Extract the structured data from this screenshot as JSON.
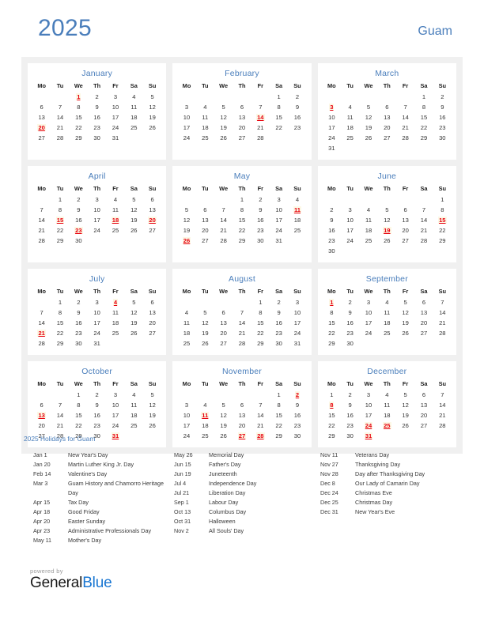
{
  "header": {
    "year": "2025",
    "country": "Guam"
  },
  "months": [
    {
      "name": "January",
      "weekdays": [
        "Mo",
        "Tu",
        "We",
        "Th",
        "Fr",
        "Sa",
        "Su"
      ],
      "weeks": [
        [
          "",
          "",
          "1",
          "2",
          "3",
          "4",
          "5"
        ],
        [
          "6",
          "7",
          "8",
          "9",
          "10",
          "11",
          "12"
        ],
        [
          "13",
          "14",
          "15",
          "16",
          "17",
          "18",
          "19"
        ],
        [
          "20",
          "21",
          "22",
          "23",
          "24",
          "25",
          "26"
        ],
        [
          "27",
          "28",
          "29",
          "30",
          "31",
          "",
          ""
        ]
      ],
      "holiday_days": [
        1,
        20
      ]
    },
    {
      "name": "February",
      "weekdays": [
        "Mo",
        "Tu",
        "We",
        "Th",
        "Fr",
        "Sa",
        "Su"
      ],
      "weeks": [
        [
          "",
          "",
          "",
          "",
          "",
          "1",
          "2"
        ],
        [
          "3",
          "4",
          "5",
          "6",
          "7",
          "8",
          "9"
        ],
        [
          "10",
          "11",
          "12",
          "13",
          "14",
          "15",
          "16"
        ],
        [
          "17",
          "18",
          "19",
          "20",
          "21",
          "22",
          "23"
        ],
        [
          "24",
          "25",
          "26",
          "27",
          "28",
          "",
          ""
        ]
      ],
      "holiday_days": [
        14
      ]
    },
    {
      "name": "March",
      "weekdays": [
        "Mo",
        "Tu",
        "We",
        "Th",
        "Fr",
        "Sa",
        "Su"
      ],
      "weeks": [
        [
          "",
          "",
          "",
          "",
          "",
          "1",
          "2"
        ],
        [
          "3",
          "4",
          "5",
          "6",
          "7",
          "8",
          "9"
        ],
        [
          "10",
          "11",
          "12",
          "13",
          "14",
          "15",
          "16"
        ],
        [
          "17",
          "18",
          "19",
          "20",
          "21",
          "22",
          "23"
        ],
        [
          "24",
          "25",
          "26",
          "27",
          "28",
          "29",
          "30"
        ],
        [
          "31",
          "",
          "",
          "",
          "",
          "",
          ""
        ]
      ],
      "holiday_days": [
        3
      ]
    },
    {
      "name": "April",
      "weekdays": [
        "Mo",
        "Tu",
        "We",
        "Th",
        "Fr",
        "Sa",
        "Su"
      ],
      "weeks": [
        [
          "",
          "1",
          "2",
          "3",
          "4",
          "5",
          "6"
        ],
        [
          "7",
          "8",
          "9",
          "10",
          "11",
          "12",
          "13"
        ],
        [
          "14",
          "15",
          "16",
          "17",
          "18",
          "19",
          "20"
        ],
        [
          "21",
          "22",
          "23",
          "24",
          "25",
          "26",
          "27"
        ],
        [
          "28",
          "29",
          "30",
          "",
          "",
          "",
          ""
        ]
      ],
      "holiday_days": [
        15,
        18,
        20,
        23
      ]
    },
    {
      "name": "May",
      "weekdays": [
        "Mo",
        "Tu",
        "We",
        "Th",
        "Fr",
        "Sa",
        "Su"
      ],
      "weeks": [
        [
          "",
          "",
          "",
          "1",
          "2",
          "3",
          "4"
        ],
        [
          "5",
          "6",
          "7",
          "8",
          "9",
          "10",
          "11"
        ],
        [
          "12",
          "13",
          "14",
          "15",
          "16",
          "17",
          "18"
        ],
        [
          "19",
          "20",
          "21",
          "22",
          "23",
          "24",
          "25"
        ],
        [
          "26",
          "27",
          "28",
          "29",
          "30",
          "31",
          ""
        ]
      ],
      "holiday_days": [
        11,
        26
      ]
    },
    {
      "name": "June",
      "weekdays": [
        "Mo",
        "Tu",
        "We",
        "Th",
        "Fr",
        "Sa",
        "Su"
      ],
      "weeks": [
        [
          "",
          "",
          "",
          "",
          "",
          "",
          "1"
        ],
        [
          "2",
          "3",
          "4",
          "5",
          "6",
          "7",
          "8"
        ],
        [
          "9",
          "10",
          "11",
          "12",
          "13",
          "14",
          "15"
        ],
        [
          "16",
          "17",
          "18",
          "19",
          "20",
          "21",
          "22"
        ],
        [
          "23",
          "24",
          "25",
          "26",
          "27",
          "28",
          "29"
        ],
        [
          "30",
          "",
          "",
          "",
          "",
          "",
          ""
        ]
      ],
      "holiday_days": [
        15,
        19
      ]
    },
    {
      "name": "July",
      "weekdays": [
        "Mo",
        "Tu",
        "We",
        "Th",
        "Fr",
        "Sa",
        "Su"
      ],
      "weeks": [
        [
          "",
          "1",
          "2",
          "3",
          "4",
          "5",
          "6"
        ],
        [
          "7",
          "8",
          "9",
          "10",
          "11",
          "12",
          "13"
        ],
        [
          "14",
          "15",
          "16",
          "17",
          "18",
          "19",
          "20"
        ],
        [
          "21",
          "22",
          "23",
          "24",
          "25",
          "26",
          "27"
        ],
        [
          "28",
          "29",
          "30",
          "31",
          "",
          "",
          ""
        ]
      ],
      "holiday_days": [
        4,
        21
      ]
    },
    {
      "name": "August",
      "weekdays": [
        "Mo",
        "Tu",
        "We",
        "Th",
        "Fr",
        "Sa",
        "Su"
      ],
      "weeks": [
        [
          "",
          "",
          "",
          "",
          "1",
          "2",
          "3"
        ],
        [
          "4",
          "5",
          "6",
          "7",
          "8",
          "9",
          "10"
        ],
        [
          "11",
          "12",
          "13",
          "14",
          "15",
          "16",
          "17"
        ],
        [
          "18",
          "19",
          "20",
          "21",
          "22",
          "23",
          "24"
        ],
        [
          "25",
          "26",
          "27",
          "28",
          "29",
          "30",
          "31"
        ]
      ],
      "holiday_days": []
    },
    {
      "name": "September",
      "weekdays": [
        "Mo",
        "Tu",
        "We",
        "Th",
        "Fr",
        "Sa",
        "Su"
      ],
      "weeks": [
        [
          "1",
          "2",
          "3",
          "4",
          "5",
          "6",
          "7"
        ],
        [
          "8",
          "9",
          "10",
          "11",
          "12",
          "13",
          "14"
        ],
        [
          "15",
          "16",
          "17",
          "18",
          "19",
          "20",
          "21"
        ],
        [
          "22",
          "23",
          "24",
          "25",
          "26",
          "27",
          "28"
        ],
        [
          "29",
          "30",
          "",
          "",
          "",
          "",
          ""
        ]
      ],
      "holiday_days": [
        1
      ]
    },
    {
      "name": "October",
      "weekdays": [
        "Mo",
        "Tu",
        "We",
        "Th",
        "Fr",
        "Sa",
        "Su"
      ],
      "weeks": [
        [
          "",
          "",
          "1",
          "2",
          "3",
          "4",
          "5"
        ],
        [
          "6",
          "7",
          "8",
          "9",
          "10",
          "11",
          "12"
        ],
        [
          "13",
          "14",
          "15",
          "16",
          "17",
          "18",
          "19"
        ],
        [
          "20",
          "21",
          "22",
          "23",
          "24",
          "25",
          "26"
        ],
        [
          "27",
          "28",
          "29",
          "30",
          "31",
          "",
          ""
        ]
      ],
      "holiday_days": [
        13,
        31
      ]
    },
    {
      "name": "November",
      "weekdays": [
        "Mo",
        "Tu",
        "We",
        "Th",
        "Fr",
        "Sa",
        "Su"
      ],
      "weeks": [
        [
          "",
          "",
          "",
          "",
          "",
          "1",
          "2"
        ],
        [
          "3",
          "4",
          "5",
          "6",
          "7",
          "8",
          "9"
        ],
        [
          "10",
          "11",
          "12",
          "13",
          "14",
          "15",
          "16"
        ],
        [
          "17",
          "18",
          "19",
          "20",
          "21",
          "22",
          "23"
        ],
        [
          "24",
          "25",
          "26",
          "27",
          "28",
          "29",
          "30"
        ]
      ],
      "holiday_days": [
        2,
        11,
        27,
        28
      ]
    },
    {
      "name": "December",
      "weekdays": [
        "Mo",
        "Tu",
        "We",
        "Th",
        "Fr",
        "Sa",
        "Su"
      ],
      "weeks": [
        [
          "1",
          "2",
          "3",
          "4",
          "5",
          "6",
          "7"
        ],
        [
          "8",
          "9",
          "10",
          "11",
          "12",
          "13",
          "14"
        ],
        [
          "15",
          "16",
          "17",
          "18",
          "19",
          "20",
          "21"
        ],
        [
          "22",
          "23",
          "24",
          "25",
          "26",
          "27",
          "28"
        ],
        [
          "29",
          "30",
          "31",
          "",
          "",
          "",
          ""
        ]
      ],
      "holiday_days": [
        8,
        24,
        25,
        31
      ]
    }
  ],
  "holidays_section": {
    "title": "2025 Holidays for Guam",
    "columns": [
      [
        {
          "date": "Jan 1",
          "name": "New Year's Day"
        },
        {
          "date": "Jan 20",
          "name": "Martin Luther King Jr. Day"
        },
        {
          "date": "Feb 14",
          "name": "Valentine's Day"
        },
        {
          "date": "Mar 3",
          "name": "Guam History and Chamorro Heritage Day"
        },
        {
          "date": "Apr 15",
          "name": "Tax Day"
        },
        {
          "date": "Apr 18",
          "name": "Good Friday"
        },
        {
          "date": "Apr 20",
          "name": "Easter Sunday"
        },
        {
          "date": "Apr 23",
          "name": "Administrative Professionals Day"
        },
        {
          "date": "May 11",
          "name": "Mother's Day"
        }
      ],
      [
        {
          "date": "May 26",
          "name": "Memorial Day"
        },
        {
          "date": "Jun 15",
          "name": "Father's Day"
        },
        {
          "date": "Jun 19",
          "name": "Juneteenth"
        },
        {
          "date": "Jul 4",
          "name": "Independence Day"
        },
        {
          "date": "Jul 21",
          "name": "Liberation Day"
        },
        {
          "date": "Sep 1",
          "name": "Labour Day"
        },
        {
          "date": "Oct 13",
          "name": "Columbus Day"
        },
        {
          "date": "Oct 31",
          "name": "Halloween"
        },
        {
          "date": "Nov 2",
          "name": "All Souls' Day"
        }
      ],
      [
        {
          "date": "Nov 11",
          "name": "Veterans Day"
        },
        {
          "date": "Nov 27",
          "name": "Thanksgiving Day"
        },
        {
          "date": "Nov 28",
          "name": "Day after Thanksgiving Day"
        },
        {
          "date": "Dec 8",
          "name": "Our Lady of Camarin Day"
        },
        {
          "date": "Dec 24",
          "name": "Christmas Eve"
        },
        {
          "date": "Dec 25",
          "name": "Christmas Day"
        },
        {
          "date": "Dec 31",
          "name": "New Year's Eve"
        }
      ]
    ]
  },
  "footer": {
    "powered_by": "powered by",
    "brand_part1": "General",
    "brand_part2": "Blue"
  },
  "colors": {
    "accent_blue": "#4a7ebb",
    "holiday_red": "#e8000d",
    "panel_bg": "#f0f0f0",
    "brand_blue": "#1976d2"
  }
}
